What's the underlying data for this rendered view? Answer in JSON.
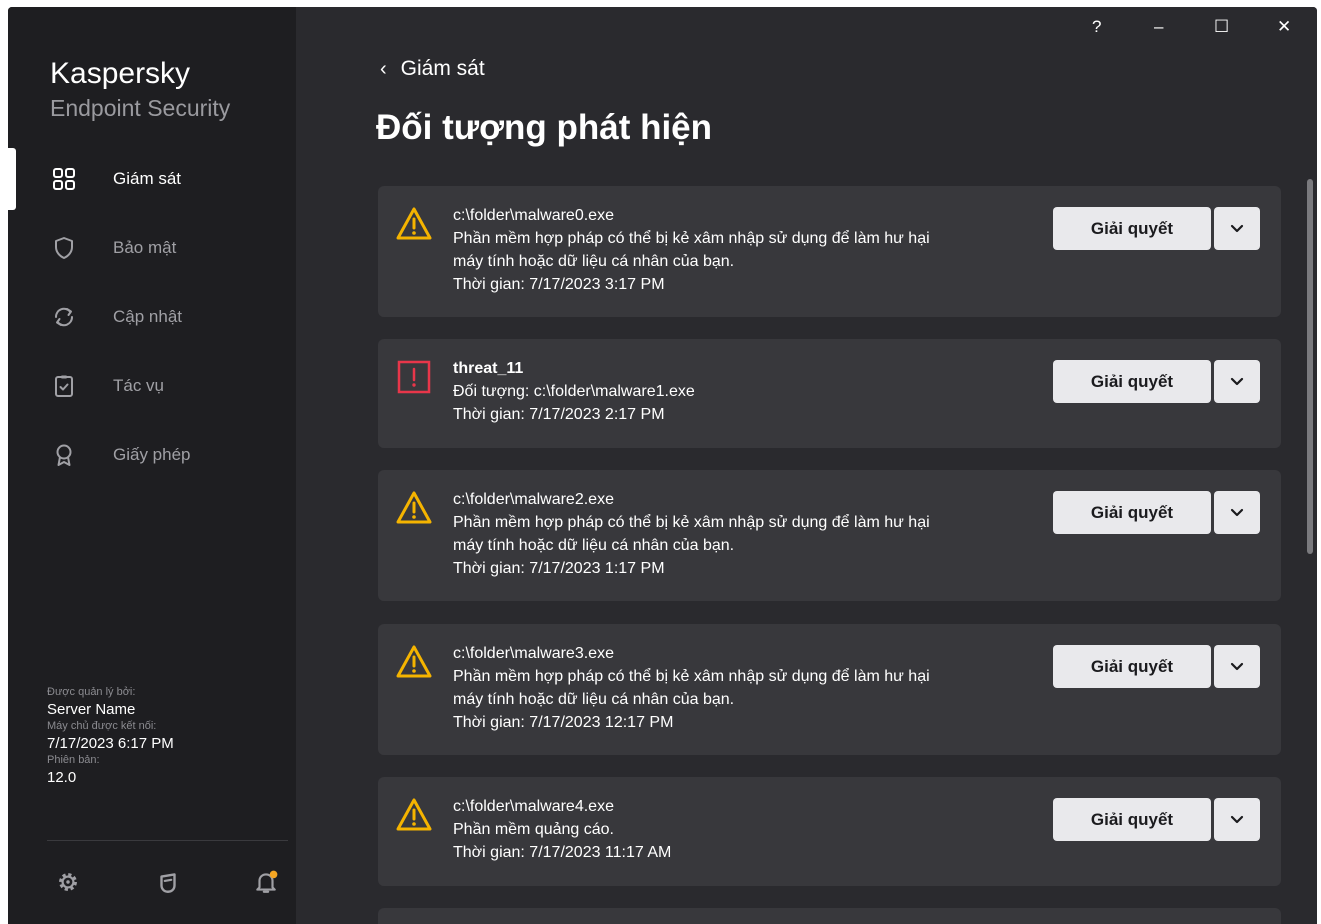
{
  "app": {
    "brand_line1": "Kaspersky",
    "brand_line2": "Endpoint Security"
  },
  "window_controls": {
    "help": "?",
    "minimize": "–",
    "maximize": "☐",
    "close": "✕"
  },
  "sidebar": {
    "items": [
      {
        "label": "Giám sát",
        "icon": "dashboard-icon",
        "active": true
      },
      {
        "label": "Bảo mật",
        "icon": "shield-icon"
      },
      {
        "label": "Cập nhật",
        "icon": "refresh-icon"
      },
      {
        "label": "Tác vụ",
        "icon": "tasks-icon"
      },
      {
        "label": "Giấy phép",
        "icon": "license-icon"
      }
    ],
    "info": {
      "managed_by_label": "Được quản lý bởi:",
      "managed_by_value": "Server Name",
      "connected_label": "Máy chủ được kết nối:",
      "connected_value": "7/17/2023 6:17 PM",
      "version_label": "Phiên bản:",
      "version_value": "12.0"
    },
    "footer_icons": [
      "settings-icon",
      "support-icon",
      "notifications-icon"
    ]
  },
  "header": {
    "back_label": "Giám sát",
    "title": "Đối tượng phát hiện"
  },
  "detections": [
    {
      "severity": "warning",
      "line1": "c:\\folder\\malware0.exe",
      "line2": "Phần mềm hợp pháp có thể bị kẻ xâm nhập sử dụng để làm hư hại",
      "line3": "máy tính hoặc dữ liệu cá nhân của bạn.",
      "line4": "Thời gian: 7/17/2023 3:17 PM",
      "button": "Giải quyết"
    },
    {
      "severity": "critical",
      "line1": "threat_11",
      "line2": "Đối tượng: c:\\folder\\malware1.exe",
      "line3": "Thời gian: 7/17/2023 2:17 PM",
      "button": "Giải quyết"
    },
    {
      "severity": "warning",
      "line1": "c:\\folder\\malware2.exe",
      "line2": "Phần mềm hợp pháp có thể bị kẻ xâm nhập sử dụng để làm hư hại",
      "line3": "máy tính hoặc dữ liệu cá nhân của bạn.",
      "line4": "Thời gian: 7/17/2023 1:17 PM",
      "button": "Giải quyết"
    },
    {
      "severity": "warning",
      "line1": "c:\\folder\\malware3.exe",
      "line2": "Phần mềm hợp pháp có thể bị kẻ xâm nhập sử dụng để làm hư hại",
      "line3": "máy tính hoặc dữ liệu cá nhân của bạn.",
      "line4": "Thời gian: 7/17/2023 12:17 PM",
      "button": "Giải quyết"
    },
    {
      "severity": "warning",
      "line1": "c:\\folder\\malware4.exe",
      "line2": "Phần mềm quảng cáo.",
      "line3": "Thời gian: 7/17/2023 11:17 AM",
      "button": "Giải quyết"
    }
  ],
  "colors": {
    "warning": "#f5b400",
    "critical": "#e8364a",
    "notification_dot": "#f5a623"
  }
}
